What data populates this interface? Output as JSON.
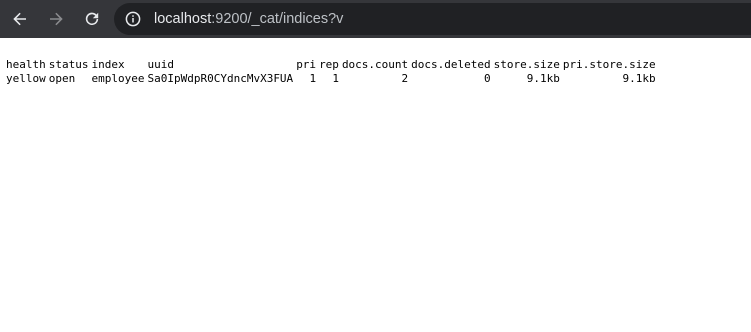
{
  "browser": {
    "url_host": "localhost",
    "url_path": ":9200/_cat/indices?v",
    "back_icon": "arrow-left-icon",
    "forward_icon": "arrow-right-icon",
    "reload_icon": "reload-icon",
    "site_info_icon": "info-circle-icon",
    "colors": {
      "toolbar_bg": "#35363a",
      "omnibox_bg": "#202124",
      "url_text": "#e8eaed"
    }
  },
  "cat_indices": {
    "headers": [
      "health",
      "status",
      "index",
      "uuid",
      "pri",
      "rep",
      "docs.count",
      "docs.deleted",
      "store.size",
      "pri.store.size"
    ],
    "rows": [
      [
        "yellow",
        "open",
        "employee",
        "Sa0IpWdpR0CYdncMvX3FUA",
        "1",
        "1",
        "2",
        "0",
        "9.1kb",
        "9.1kb"
      ]
    ]
  }
}
